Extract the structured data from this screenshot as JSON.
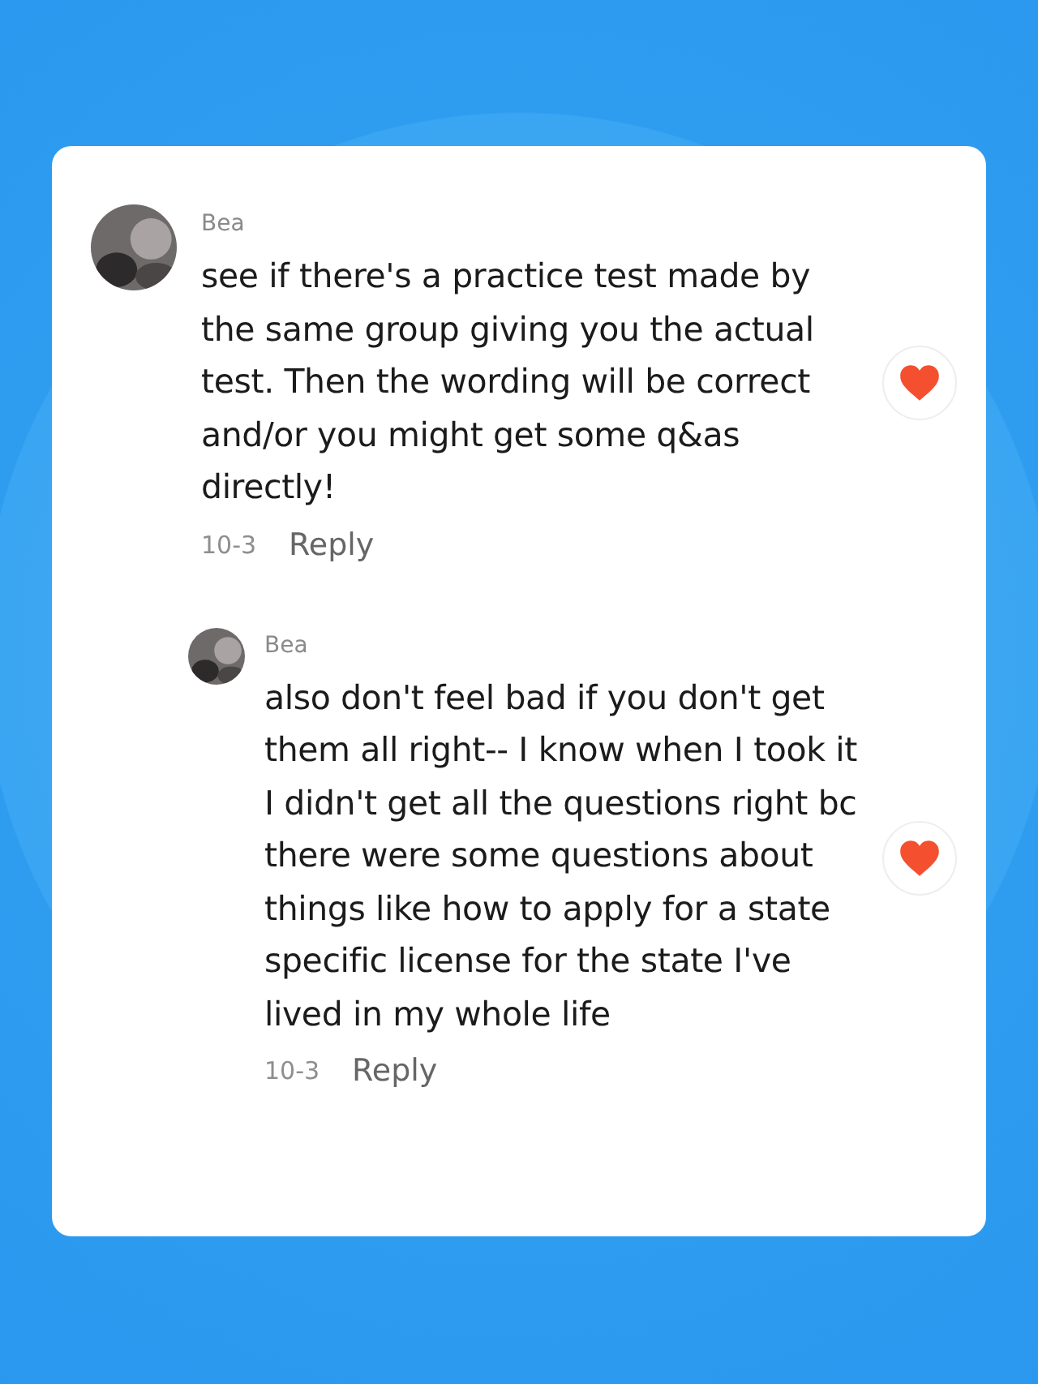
{
  "comments": [
    {
      "author": "Bea",
      "text": "see if there's a practice test made by the same group giving you the actual test. Then the wording will be correct and/or you might get some q&as directly!",
      "date": "10-3",
      "reply_label": "Reply",
      "liked": true,
      "children": [
        {
          "author": "Bea",
          "text": "also don't feel bad if you don't get them all right-- I know when I took it I didn't get all the questions right bc there were some questions about things like how to apply for a state specific license for the state I've lived in my whole life",
          "date": "10-3",
          "reply_label": "Reply",
          "liked": true
        }
      ]
    }
  ]
}
